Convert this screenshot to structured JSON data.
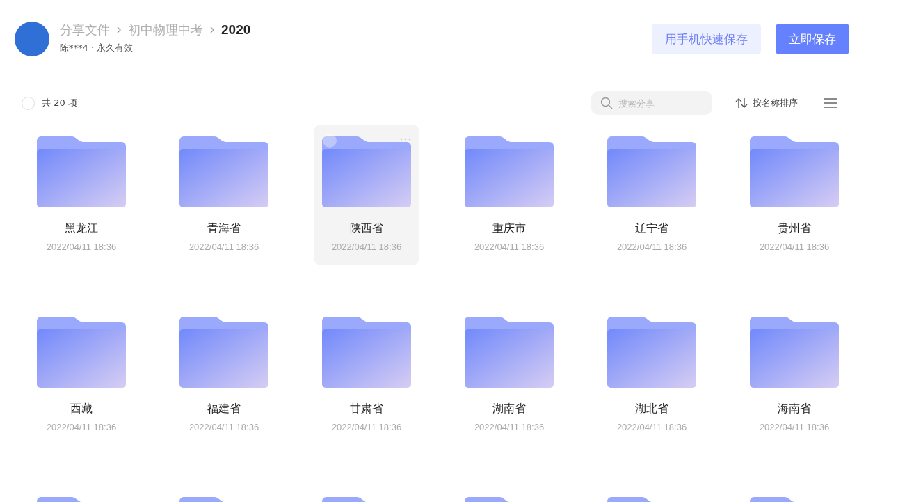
{
  "header": {
    "breadcrumb": [
      {
        "label": "分享文件"
      },
      {
        "label": "初中物理中考"
      }
    ],
    "current_folder": "2020",
    "owner": "陈***4 · 永久有效",
    "buttons": [
      {
        "label": "用手机快速保存",
        "kind": "secondary"
      },
      {
        "label": "立即保存",
        "kind": "primary"
      }
    ]
  },
  "toolbar": {
    "select_all": {
      "checked": false
    },
    "count": "共 20 项",
    "search": {
      "placeholder": "搜索分享"
    },
    "sort": "按名称排序"
  },
  "items": [
    {
      "kind": "folder",
      "name": "黑龙江",
      "date": "2022/04/11 18:36",
      "hovered": false
    },
    {
      "kind": "folder",
      "name": "青海省",
      "date": "2022/04/11 18:36",
      "hovered": false
    },
    {
      "kind": "folder",
      "name": "陕西省",
      "date": "2022/04/11 18:36",
      "hovered": true
    },
    {
      "kind": "folder",
      "name": "重庆市",
      "date": "2022/04/11 18:36",
      "hovered": false
    },
    {
      "kind": "folder",
      "name": "辽宁省",
      "date": "2022/04/11 18:36",
      "hovered": false
    },
    {
      "kind": "folder",
      "name": "贵州省",
      "date": "2022/04/11 18:36",
      "hovered": false
    },
    {
      "kind": "folder",
      "name": "西藏",
      "date": "2022/04/11 18:36",
      "hovered": false
    },
    {
      "kind": "folder",
      "name": "福建省",
      "date": "2022/04/11 18:36",
      "hovered": false
    },
    {
      "kind": "folder",
      "name": "甘肃省",
      "date": "2022/04/11 18:36",
      "hovered": false
    },
    {
      "kind": "folder",
      "name": "湖南省",
      "date": "2022/04/11 18:36",
      "hovered": false
    },
    {
      "kind": "folder",
      "name": "湖北省",
      "date": "2022/04/11 18:36",
      "hovered": false
    },
    {
      "kind": "folder",
      "name": "海南省",
      "date": "2022/04/11 18:36",
      "hovered": false
    },
    {
      "kind": "folder_cut",
      "hovered": false
    },
    {
      "kind": "folder_cut",
      "hovered": false
    },
    {
      "kind": "folder_cut",
      "hovered": false
    },
    {
      "kind": "folder_cut",
      "hovered": false
    },
    {
      "kind": "folder_cut",
      "hovered": false
    },
    {
      "kind": "folder_cut",
      "hovered": false
    }
  ]
}
